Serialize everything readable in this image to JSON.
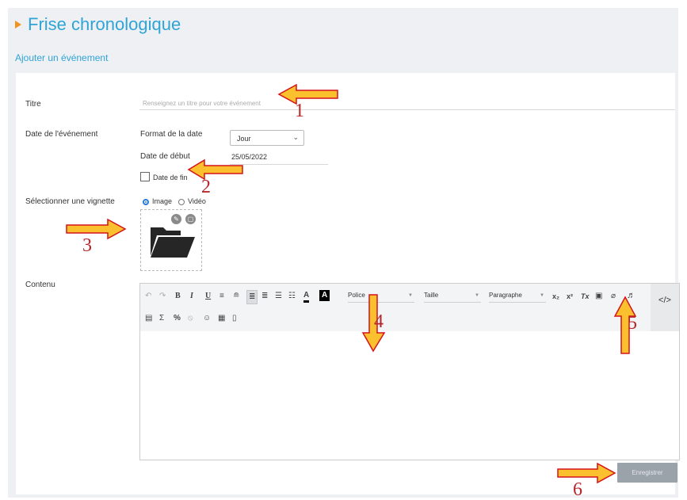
{
  "page": {
    "title": "Frise chronologique",
    "section_title": "Ajouter un événement"
  },
  "form": {
    "titre_label": "Titre",
    "titre_placeholder": "Renseignez un titre pour votre événement",
    "date_label": "Date de l'événement",
    "format_label": "Format de la date",
    "format_value": "Jour",
    "debut_label": "Date de début",
    "debut_value": "25/05/2022",
    "fin_label": "Date de fin",
    "vignette_label": "Sélectionner une vignette",
    "vignette_options": [
      "Image",
      "Vidéo"
    ],
    "contenu_label": "Contenu"
  },
  "toolbar": {
    "police": "Police",
    "taille": "Taille",
    "paragraphe": "Paragraphe",
    "code_view": "</>",
    "glyphs": {
      "undo": "↶",
      "redo": "↷",
      "bold": "B",
      "italic": "I",
      "underline": "U",
      "align_justify": "≡",
      "align_center": "≘",
      "align_left": "≣",
      "align_right": "≣",
      "list_bullet": "☰",
      "list_number": "☷",
      "font_color": "A",
      "bg_color": "A",
      "subscript": "x₂",
      "superscript": "x²",
      "clear_format": "Tx",
      "image": "▣",
      "attach": "⌀",
      "audio": "♬",
      "video": "▤",
      "sigma": "Σ",
      "link": "%",
      "unlink": "⦸",
      "emoji": "☺",
      "table": "▦",
      "document": "▯"
    }
  },
  "save_button": "Enregistrer",
  "annotations": [
    "1",
    "2",
    "3",
    "4",
    "5",
    "6"
  ],
  "colors": {
    "accent": "#2fa4d6",
    "arrow_fill": "#fbc02d",
    "arrow_stroke": "#d4131b",
    "number": "#b5262a"
  }
}
